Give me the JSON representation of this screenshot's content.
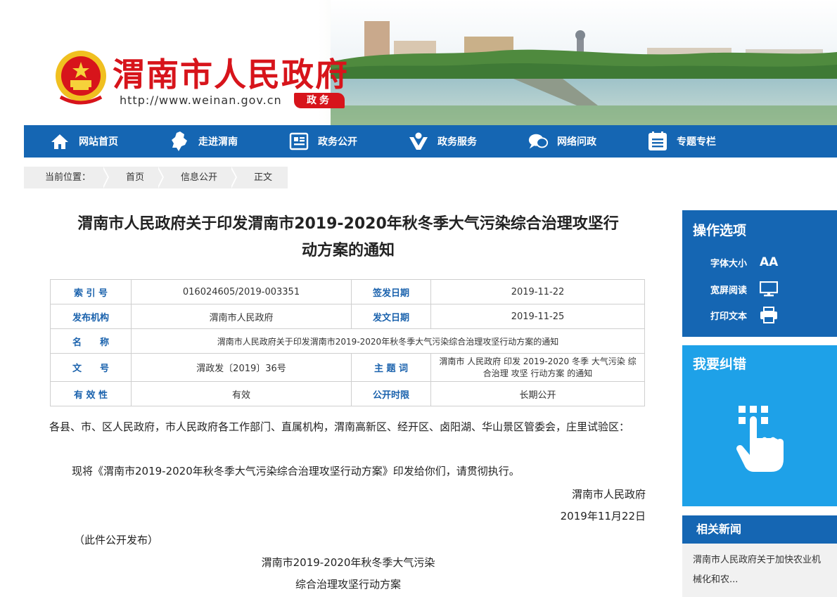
{
  "header": {
    "site_name": "渭南市人民政府",
    "url": "http://www.weinan.gov.cn",
    "tag": "政务"
  },
  "nav": {
    "items": [
      {
        "label": "网站首页",
        "icon": "home-icon"
      },
      {
        "label": "走进渭南",
        "icon": "map-icon"
      },
      {
        "label": "政务公开",
        "icon": "document-icon"
      },
      {
        "label": "政务服务",
        "icon": "service-person-icon"
      },
      {
        "label": "网络问政",
        "icon": "chat-icon"
      },
      {
        "label": "专题专栏",
        "icon": "list-icon"
      }
    ]
  },
  "breadcrumb": {
    "prefix": "当前位置：",
    "items": [
      "首页",
      "信息公开",
      "正文"
    ]
  },
  "article": {
    "title_line1": "渭南市人民政府关于印发渭南市2019-2020年秋冬季大气污染综合治理攻坚行",
    "title_line2": "动方案的通知",
    "meta": {
      "index_label": "索 引 号",
      "index_value": "016024605/2019-003351",
      "sign_date_label": "签发日期",
      "sign_date_value": "2019-11-22",
      "publisher_label": "发布机构",
      "publisher_value": "渭南市人民政府",
      "issue_date_label": "发文日期",
      "issue_date_value": "2019-11-25",
      "name_label": "名　　称",
      "name_value": "渭南市人民政府关于印发渭南市2019-2020年秋冬季大气污染综合治理攻坚行动方案的通知",
      "doc_no_label": "文　　号",
      "doc_no_value": "渭政发〔2019〕36号",
      "keywords_label": "主 题 词",
      "keywords_value": "渭南市 人民政府 印发 2019-2020 冬季 大气污染 综合治理 攻坚 行动方案 的通知",
      "validity_label": "有 效 性",
      "validity_value": "有效",
      "disclosure_label": "公开时限",
      "disclosure_value": "长期公开"
    },
    "para1": "各县、市、区人民政府，市人民政府各工作部门、直属机构，渭南高新区、经开区、卤阳湖、华山景区管委会，庄里试验区：",
    "para2": "现将《渭南市2019-2020年秋冬季大气污染综合治理攻坚行动方案》印发给你们，请贯彻执行。",
    "signer": "渭南市人民政府",
    "sign_date": "2019年11月22日",
    "note": "（此件公开发布）",
    "sub_title1": "渭南市2019-2020年秋冬季大气污染",
    "sub_title2": "综合治理攻坚行动方案"
  },
  "sidebar": {
    "ops_title": "操作选项",
    "font_size_label": "字体大小",
    "font_size_icon_text": "AA",
    "wide_read_label": "宽屏阅读",
    "print_label": "打印文本",
    "error_title": "我要纠错",
    "news_title": "相关新闻",
    "news_item": "渭南市人民政府关于加快农业机械化和农..."
  },
  "colors": {
    "brand_red": "#d7141b",
    "nav_blue": "#1566b3",
    "error_blue": "#1ea1e8",
    "label_blue": "#1a62ad"
  }
}
